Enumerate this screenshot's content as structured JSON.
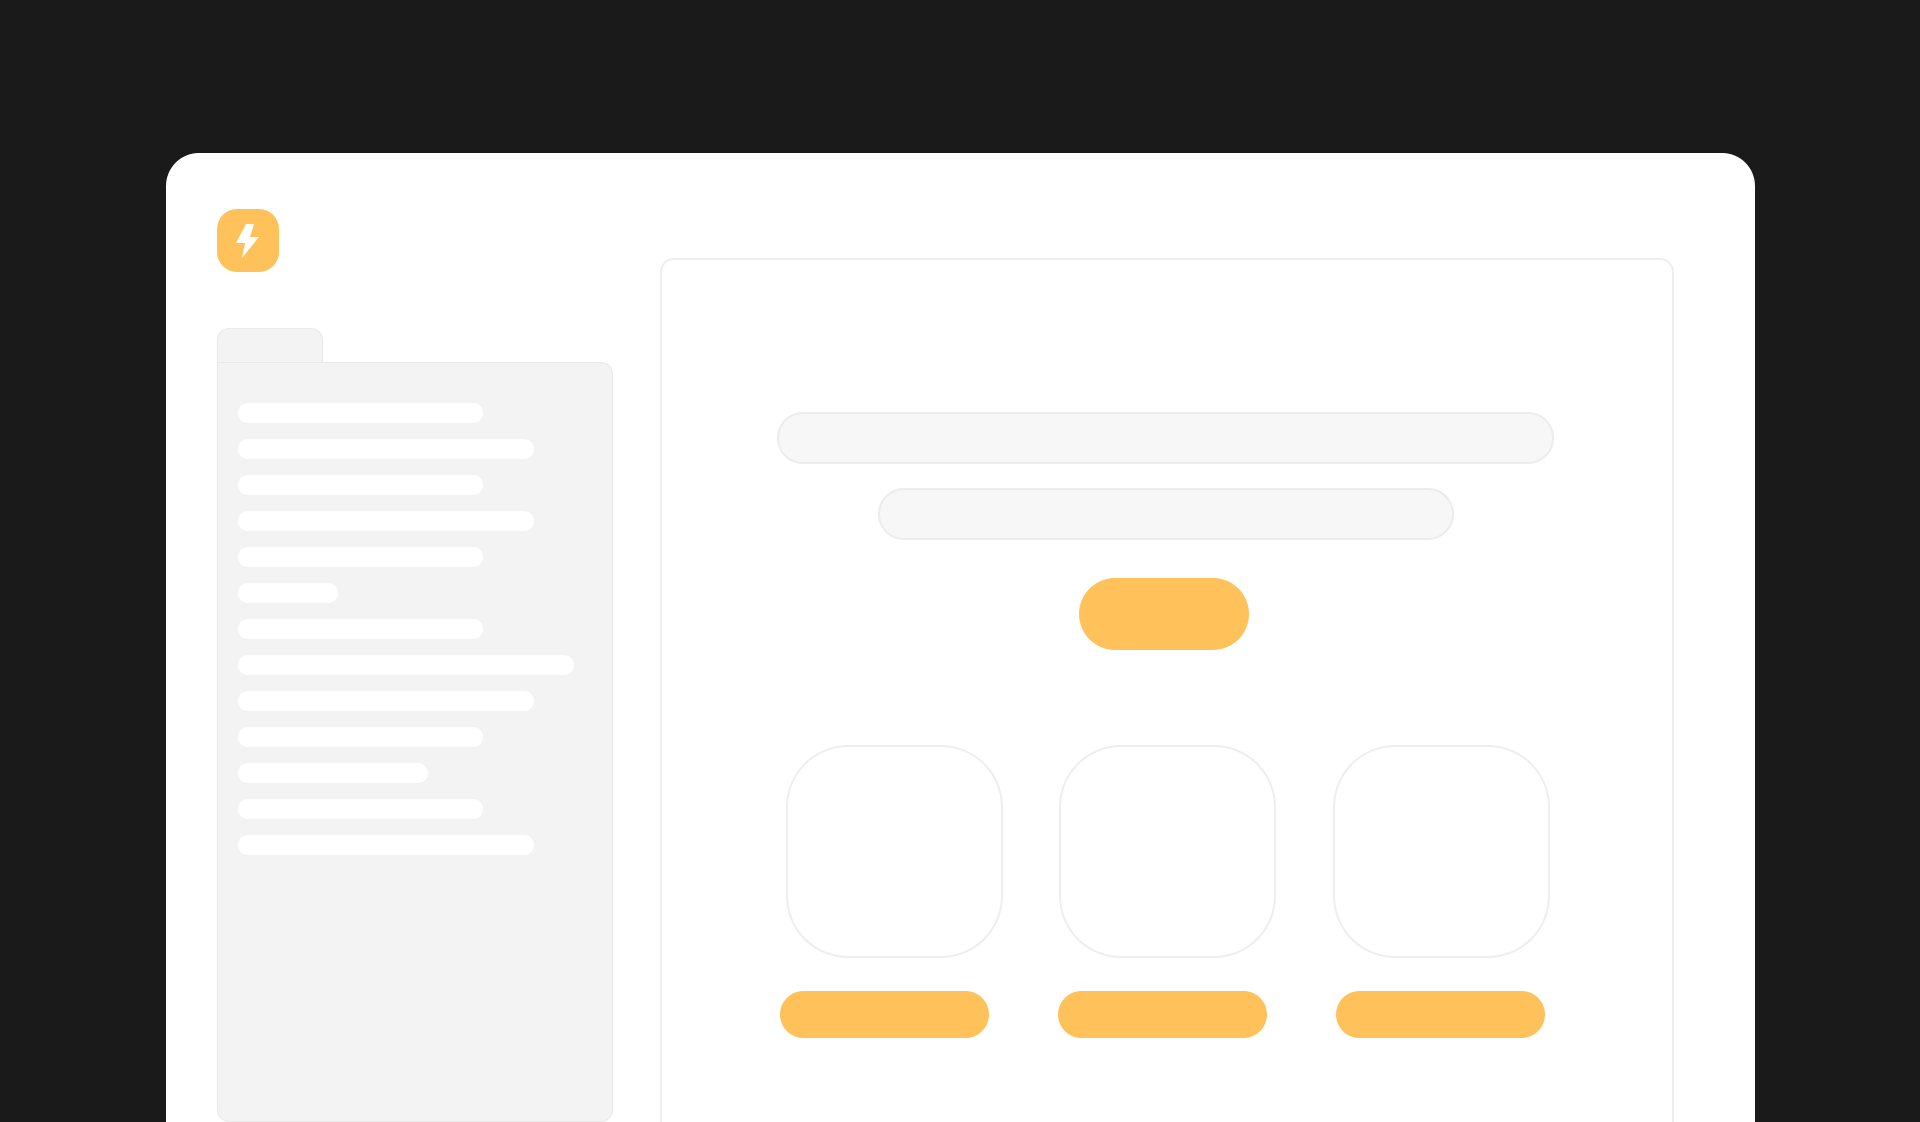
{
  "theme": {
    "background": "#1a1a1a",
    "window": "#ffffff",
    "accent": "#ffc15a",
    "sidebar": "#f3f3f3",
    "placeholder": "#f7f7f7"
  },
  "logo": {
    "icon": "lightning-bolt-icon"
  },
  "sidebar": {
    "items": [
      {
        "label": ""
      },
      {
        "label": ""
      },
      {
        "label": ""
      },
      {
        "label": ""
      },
      {
        "label": ""
      },
      {
        "label": ""
      },
      {
        "label": ""
      },
      {
        "label": ""
      },
      {
        "label": ""
      },
      {
        "label": ""
      },
      {
        "label": ""
      },
      {
        "label": ""
      },
      {
        "label": ""
      }
    ]
  },
  "main": {
    "heading": "",
    "subheading": "",
    "cta_label": "",
    "cards": [
      {
        "label": ""
      },
      {
        "label": ""
      },
      {
        "label": ""
      }
    ]
  }
}
